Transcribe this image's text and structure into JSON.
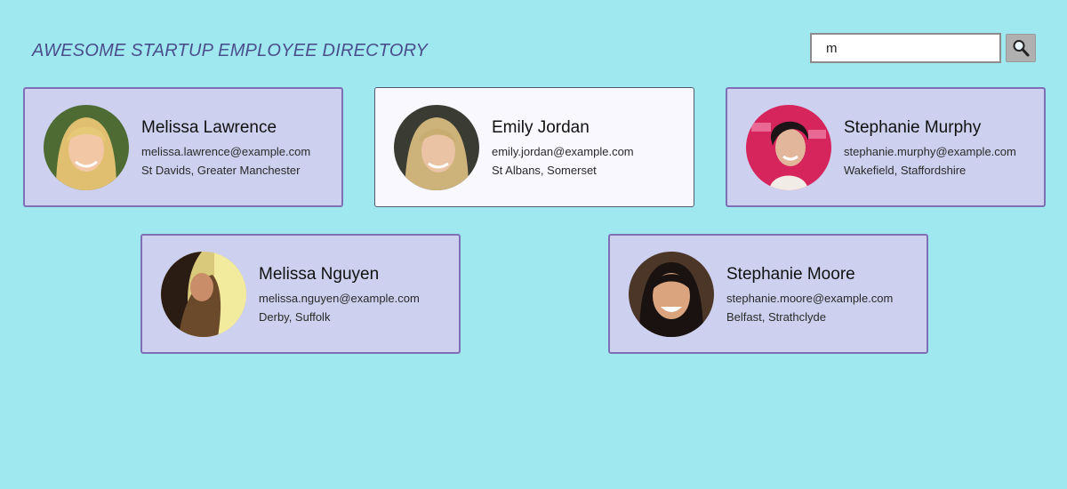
{
  "header": {
    "title": "AWESOME STARTUP EMPLOYEE DIRECTORY"
  },
  "search": {
    "value": "m",
    "button_icon": "search-icon"
  },
  "employees": [
    {
      "name": "Melissa Lawrence",
      "email": "melissa.lawrence@example.com",
      "location": "St Davids, Greater Manchester",
      "avatar": "employee-photo"
    },
    {
      "name": "Emily Jordan",
      "email": "emily.jordan@example.com",
      "location": "St Albans, Somerset",
      "avatar": "employee-photo"
    },
    {
      "name": "Stephanie Murphy",
      "email": "stephanie.murphy@example.com",
      "location": "Wakefield, Staffordshire",
      "avatar": "employee-photo"
    },
    {
      "name": "Melissa Nguyen",
      "email": "melissa.nguyen@example.com",
      "location": "Derby, Suffolk",
      "avatar": "employee-photo"
    },
    {
      "name": "Stephanie Moore",
      "email": "stephanie.moore@example.com",
      "location": "Belfast, Strathclyde",
      "avatar": "employee-photo"
    }
  ],
  "colors": {
    "background": "#a0e8f0",
    "card": "#cdd0ee",
    "card_active": "#f8f8fe",
    "card_border": "#7f6fb5",
    "title": "#4a4f8c"
  }
}
